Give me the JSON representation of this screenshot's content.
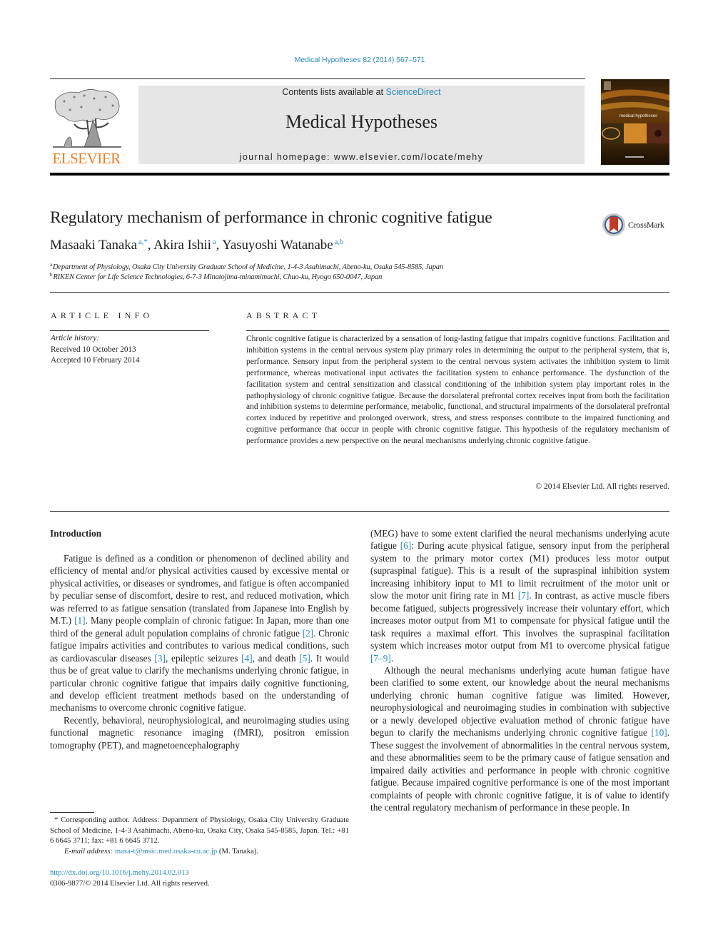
{
  "header": {
    "journal_ref": "Medical Hypotheses 82 (2014) 567–571",
    "contents_prefix": "Contents lists available at ",
    "contents_link": "ScienceDirect",
    "journal_name": "Medical Hypotheses",
    "homepage_prefix": "journal homepage: ",
    "homepage_url": "www.elsevier.com/locate/mehy",
    "publisher_logo_text": "ELSEVIER",
    "cover_title": "medical hypotheses"
  },
  "article": {
    "title": "Regulatory mechanism of performance in chronic cognitive fatigue",
    "crossmark_label": "CrossMark",
    "authors": [
      {
        "name": "Masaaki Tanaka",
        "sup": "a,*",
        "sep": ", "
      },
      {
        "name": "Akira Ishii",
        "sup": "a",
        "sep": ", "
      },
      {
        "name": "Yasuyoshi Watanabe",
        "sup": "a,b",
        "sep": ""
      }
    ],
    "affiliations": [
      {
        "label": "a",
        "text": "Department of Physiology, Osaka City University Graduate School of Medicine, 1-4-3 Asahimachi, Abeno-ku, Osaka 545-8585, Japan"
      },
      {
        "label": "b",
        "text": "RIKEN Center for Life Science Technologies, 6-7-3 Minatojima-minamimachi, Chuo-ku, Hyogo 650-0047, Japan"
      }
    ]
  },
  "article_info": {
    "heading": "ARTICLE INFO",
    "history_label": "Article history:",
    "received": "Received 10 October 2013",
    "accepted": "Accepted 10 February 2014"
  },
  "abstract": {
    "heading": "ABSTRACT",
    "text": "Chronic cognitive fatigue is characterized by a sensation of long-lasting fatigue that impairs cognitive functions. Facilitation and inhibition systems in the central nervous system play primary roles in determining the output to the peripheral system, that is, performance. Sensory input from the peripheral system to the central nervous system activates the inhibition system to limit performance, whereas motivational input activates the facilitation system to enhance performance. The dysfunction of the facilitation system and central sensitization and classical conditioning of the inhibition system play important roles in the pathophysiology of chronic cognitive fatigue. Because the dorsolateral prefrontal cortex receives input from both the facilitation and inhibition systems to determine performance, metabolic, functional, and structural impairments of the dorsolateral prefrontal cortex induced by repetitive and prolonged overwork, stress, and stress responses contribute to the impaired functioning and cognitive performance that occur in people with chronic cognitive fatigue. This hypothesis of the regulatory mechanism of performance provides a new perspective on the neural mechanisms underlying chronic cognitive fatigue.",
    "copyright": "© 2014 Elsevier Ltd. All rights reserved."
  },
  "body": {
    "intro_heading": "Introduction",
    "p1": [
      {
        "t": "Fatigue is defined as a condition or phenomenon of declined ability and efficiency of mental and/or physical activities caused by excessive mental or physical activities, or diseases or syndromes, and fatigue is often accompanied by peculiar sense of discomfort, desire to rest, and reduced motivation, which was referred to as fatigue sensation (translated from Japanese into English by M.T.) "
      },
      {
        "ref": "[1]"
      },
      {
        "t": ". Many people complain of chronic fatigue: In Japan, more than one third of the general adult population complains of chronic fatigue "
      },
      {
        "ref": "[2]"
      },
      {
        "t": ". Chronic fatigue impairs activities and contributes to various medical conditions, such as cardiovascular diseases "
      },
      {
        "ref": "[3]"
      },
      {
        "t": ", epileptic seizures "
      },
      {
        "ref": "[4]"
      },
      {
        "t": ", and death "
      },
      {
        "ref": "[5]"
      },
      {
        "t": ". It would thus be of great value to clarify the mechanisms underlying chronic fatigue, in particular chronic cognitive fatigue that impairs daily cognitive functioning, and develop efficient treatment methods based on the understanding of mechanisms to overcome chronic cognitive fatigue."
      }
    ],
    "p2_left": "Recently, behavioral, neurophysiological, and neuroimaging studies using functional magnetic resonance imaging (fMRI), positron emission tomography (PET), and magnetoencephalography",
    "p2_right": [
      {
        "t": "(MEG) have to some extent clarified the neural mechanisms underlying acute fatigue "
      },
      {
        "ref": "[6]"
      },
      {
        "t": ": During acute physical fatigue, sensory input from the peripheral system to the primary motor cortex (M1) produces less motor output (supraspinal fatigue). This is a result of the supraspinal inhibition system increasing inhibitory input to M1 to limit recruitment of the motor unit or slow the motor unit firing rate in M1 "
      },
      {
        "ref": "[7]"
      },
      {
        "t": ". In contrast, as active muscle fibers become fatigued, subjects progressively increase their voluntary effort, which increases motor output from M1 to compensate for physical fatigue until the task requires a maximal effort. This involves the supraspinal facilitation system which increases motor output from M1 to overcome physical fatigue "
      },
      {
        "ref": "[7–9]"
      },
      {
        "t": "."
      }
    ],
    "p3": [
      {
        "t": "Although the neural mechanisms underlying acute human fatigue have been clarified to some extent, our knowledge about the neural mechanisms underlying chronic human cognitive fatigue was limited. However, neurophysiological and neuroimaging studies in combination with subjective or a newly developed objective evaluation method of chronic fatigue have begun to clarify the mechanisms underlying chronic cognitive fatigue "
      },
      {
        "ref": "[10]"
      },
      {
        "t": ". These suggest the involvement of abnormalities in the central nervous system, and these abnormalities seem to be the primary cause of fatigue sensation and impaired daily activities and performance in people with chronic cognitive fatigue. Because impaired cognitive performance is one of the most important complaints of people with chronic cognitive fatigue, it is of value to identify the central regulatory mechanism of performance in these people. In"
      }
    ]
  },
  "footnote": {
    "corresponding": "* Corresponding author. Address: Department of Physiology, Osaka City University Graduate School of Medicine, 1-4-3 Asahimachi, Abeno-ku, Osaka City, Osaka 545-8585, Japan. Tel.: +81 6 6645 3711; fax: +81 6 6645 3712.",
    "email_label": "E-mail address: ",
    "email": "masa-t@msic.med.osaka-cu.ac.jp",
    "email_suffix": " (M. Tanaka).",
    "doi": "http://dx.doi.org/10.1016/j.mehy.2014.02.013",
    "issn_copyright": "0306-9877/© 2014 Elsevier Ltd. All rights reserved."
  },
  "colors": {
    "link": "#2a8ab8",
    "elsevier_orange": "#f07c22",
    "masthead_bg": "#e6e6e6",
    "text": "#231f20"
  }
}
